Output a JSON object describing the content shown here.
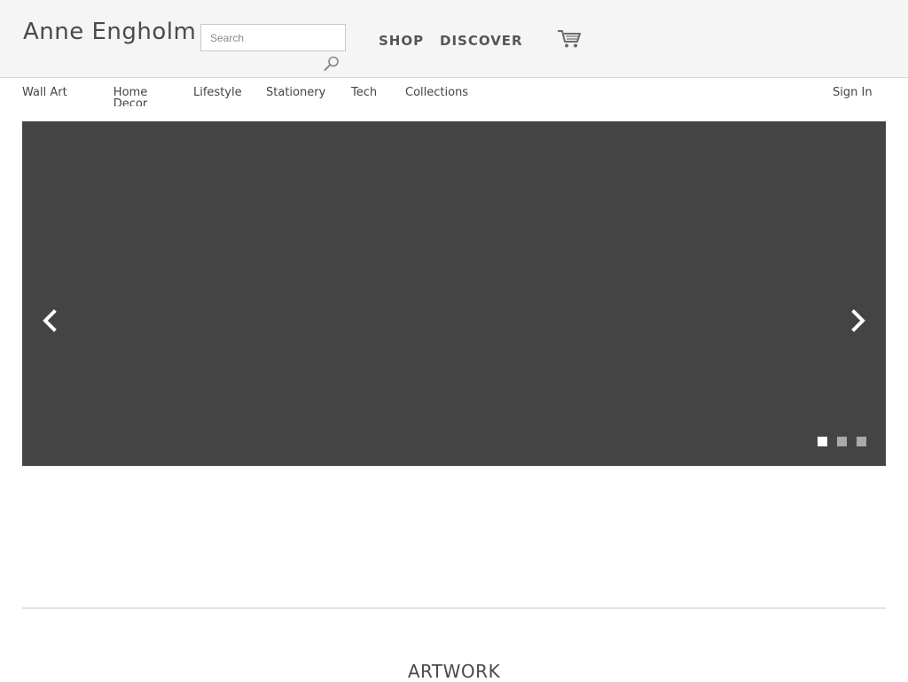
{
  "header": {
    "site_title": "Anne Engholm",
    "search": {
      "placeholder": "Search",
      "value": ""
    },
    "links": {
      "shop": "SHOP",
      "discover": "DISCOVER"
    },
    "icons": {
      "search": "magnifier-icon",
      "cart": "cart-icon"
    }
  },
  "nav": {
    "items": [
      "Wall Art",
      "Home Decor",
      "Lifestyle",
      "Stationery",
      "Tech",
      "Collections"
    ],
    "sign_in": "Sign In"
  },
  "carousel": {
    "background": "#444444",
    "current_slide": 1,
    "slide_count": 3,
    "icons": {
      "prev": "chevron-left-icon",
      "next": "chevron-right-icon"
    }
  },
  "section": {
    "title": "ARTWORK"
  }
}
